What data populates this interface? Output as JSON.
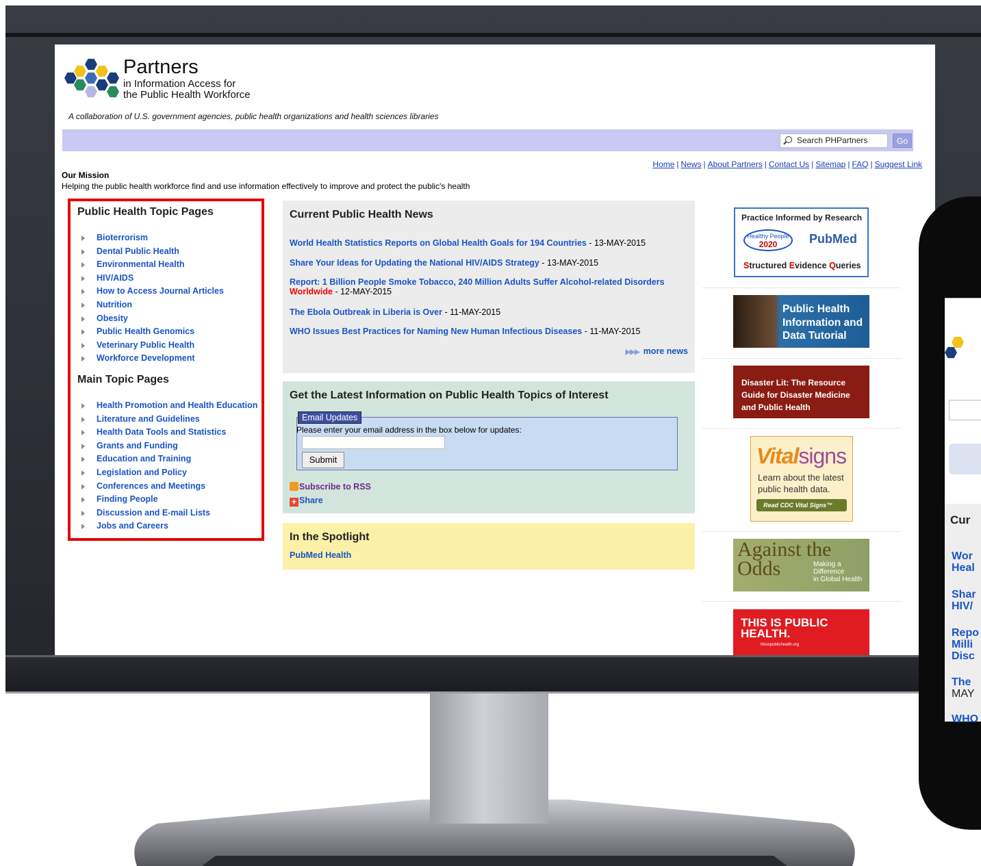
{
  "site": {
    "logo_title": "Partners",
    "logo_sub1": "in Information Access for",
    "logo_sub2": "the Public Health Workforce",
    "tagline": "A collaboration of U.S. government agencies, public health organizations and health sciences libraries"
  },
  "search": {
    "label": "Search PHPartners",
    "go": "Go"
  },
  "topnav": [
    "Home",
    "News",
    "About Partners",
    "Contact Us",
    "Sitemap",
    "FAQ",
    "Suggest Link"
  ],
  "mission": {
    "heading": "Our Mission",
    "text": "Helping the public health workforce find and use information effectively to improve and protect the public's health"
  },
  "left": {
    "heading1": "Public Health Topic Pages",
    "topics1": [
      "Bioterrorism",
      "Dental Public Health",
      "Environmental Health",
      "HIV/AIDS",
      "How to Access Journal Articles",
      "Nutrition",
      "Obesity",
      "Public Health Genomics",
      "Veterinary Public Health",
      "Workforce Development"
    ],
    "heading2": "Main Topic Pages",
    "topics2": [
      "Health Promotion and Health Education",
      "Literature and Guidelines",
      "Health Data Tools and Statistics",
      "Grants and Funding",
      "Education and Training",
      "Legislation and Policy",
      "Conferences and Meetings",
      "Finding People",
      "Discussion and E-mail Lists",
      "Jobs and Careers"
    ]
  },
  "news": {
    "heading": "Current Public Health News",
    "items": [
      {
        "title": "World Health Statistics Reports on Global Health Goals for 194 Countries",
        "date": " - 13-MAY-2015"
      },
      {
        "title": "Share Your Ideas for Updating the National HIV/AIDS Strategy",
        "date": " - 13-MAY-2015"
      },
      {
        "title": "Report: 1 Billion People Smoke Tobacco, 240 Million Adults Suffer Alcohol-related Disorders",
        "title_red": "Worldwide",
        "date": " - 12-MAY-2015"
      },
      {
        "title": "The Ebola Outbreak in Liberia is Over",
        "date": " - 11-MAY-2015"
      },
      {
        "title": "WHO Issues Best Practices for Naming New Human Infectious Diseases",
        "date": " - 11-MAY-2015"
      }
    ],
    "more": "more news"
  },
  "updates": {
    "heading": "Get the Latest Information on Public Health Topics of Interest",
    "legend": "Email Updates",
    "instructions": "Please enter your email address in the box below for updates:",
    "email_value": "",
    "submit": "Submit",
    "rss": "Subscribe to RSS",
    "share": "Share"
  },
  "spotlight": {
    "heading": "In the Spotlight",
    "link": "PubMed Health"
  },
  "ads": {
    "ad1_title": "Practice Informed by Research",
    "ad1_hp": "Healthy People",
    "ad1_hp_year": "2020",
    "ad1_pubmed": "PubMed",
    "ad1_s": "S",
    "ad1_structured": "tructured ",
    "ad1_e": "E",
    "ad1_evidence": "vidence ",
    "ad1_q": "Q",
    "ad1_queries": "ueries",
    "ad2_line1": "Public Health",
    "ad2_line2": "Information and",
    "ad2_line3": "Data Tutorial",
    "ad3_line1": "Disaster Lit: The Resource",
    "ad3_line2": "Guide for Disaster Medicine",
    "ad3_line3": "and Public Health",
    "ad4_vital": "Vital",
    "ad4_signs": "signs",
    "ad4_line1": "Learn about the latest",
    "ad4_line2": "public health data.",
    "ad4_button": "Read CDC Vital Signs™",
    "ad5_big": "Against the Odds",
    "ad5_l1": "Making a",
    "ad5_l2": "Difference",
    "ad5_l3": "in Global Health",
    "ad6_line1": "THIS IS PUBLIC",
    "ad6_line2": "HEALTH.",
    "ad6_url": "thisispublichealth.org"
  },
  "tablet": {
    "news": [
      "Wor",
      "Heal",
      "Shar",
      "HIV/",
      "Repo",
      "Milli",
      "Disc",
      "The",
      "MAY",
      "WHO"
    ],
    "heading": "Cur"
  }
}
